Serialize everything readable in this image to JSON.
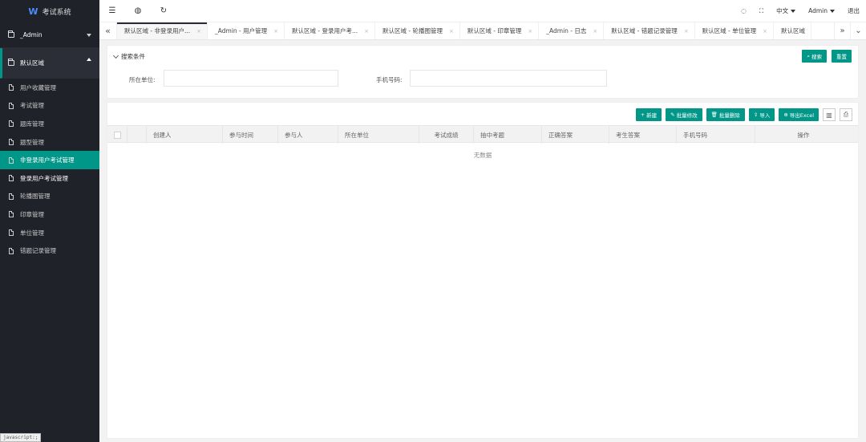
{
  "app": {
    "logo": "W",
    "title": "考试系统"
  },
  "sidebar": {
    "group_admin": "_Admin",
    "group_default": "默认区域",
    "items": [
      {
        "label": "用户收藏管理",
        "active": false
      },
      {
        "label": "考试管理",
        "active": false
      },
      {
        "label": "题库管理",
        "active": false
      },
      {
        "label": "题型管理",
        "active": false
      },
      {
        "label": "非登录用户考试管理",
        "active": true
      },
      {
        "label": "登录用户考试管理",
        "active": false
      },
      {
        "label": "轮播图管理",
        "active": false
      },
      {
        "label": "印章管理",
        "active": false
      },
      {
        "label": "单位管理",
        "active": false
      },
      {
        "label": "错题记录管理",
        "active": false
      }
    ],
    "status_tip": "javascript:;"
  },
  "header": {
    "language": "中文",
    "user": "Admin",
    "logout": "退出"
  },
  "tabs": [
    {
      "label": "默认区域 - 非登录用户...",
      "active": true
    },
    {
      "label": "_Admin - 用户管理",
      "active": false
    },
    {
      "label": "默认区域 - 登录用户考...",
      "active": false
    },
    {
      "label": "默认区域 - 轮播图管理",
      "active": false
    },
    {
      "label": "默认区域 - 印章管理",
      "active": false
    },
    {
      "label": "_Admin - 日志",
      "active": false
    },
    {
      "label": "默认区域 - 错题记录管理",
      "active": false
    },
    {
      "label": "默认区域 - 单位管理",
      "active": false
    },
    {
      "label": "默认区域",
      "active": false
    }
  ],
  "search": {
    "title": "搜索条件",
    "search_btn": "搜索",
    "reset_btn": "重置",
    "unit_label": "所在单位:",
    "unit_value": "",
    "phone_label": "手机号码:",
    "phone_value": ""
  },
  "toolbar": {
    "add": "新建",
    "batch_edit": "批量修改",
    "batch_delete": "批量删除",
    "import": "导入",
    "export": "导出Excel"
  },
  "table": {
    "columns": [
      "创建人",
      "参与时间",
      "参与人",
      "所在单位",
      "考试成绩",
      "抽中考题",
      "正确答案",
      "考生答案",
      "手机号码",
      "操作"
    ],
    "empty_text": "无数据"
  },
  "colors": {
    "accent": "#009688",
    "sidebar_bg": "#20222a"
  }
}
